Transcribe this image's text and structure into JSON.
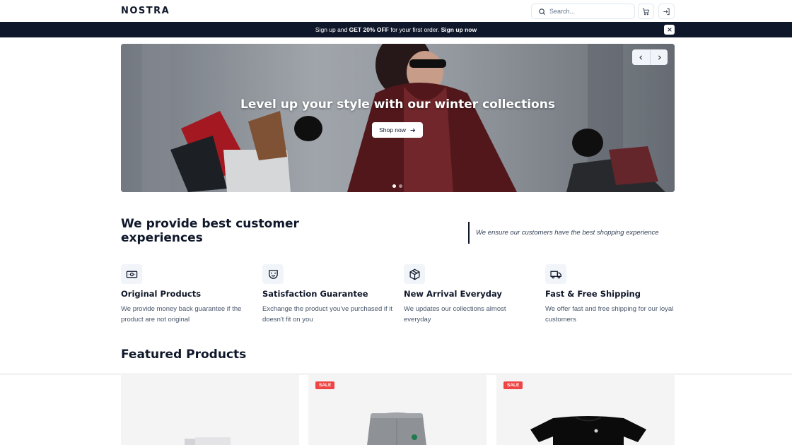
{
  "brand": {
    "logo": "NOSTRA"
  },
  "header": {
    "search": {
      "placeholder": "Search..."
    },
    "cart_icon": "cart-icon",
    "login_icon": "login-icon"
  },
  "announcement": {
    "text_1": "Sign up and ",
    "highlight": "GET 20% OFF",
    "text_2": " for your first order. ",
    "cta": "Sign up now",
    "close_icon": "close-icon"
  },
  "hero": {
    "title": "Level up your style with our winter collections",
    "button_label": "Shop now",
    "slide_count": 2,
    "active_slide": 1
  },
  "experience": {
    "title": "We provide best customer experiences",
    "subtitle": "We ensure our customers have the best shopping experience",
    "features": [
      {
        "icon": "money-icon",
        "title": "Original Products",
        "desc": "We provide money back guarantee if the product are not original"
      },
      {
        "icon": "smile-mask-icon",
        "title": "Satisfaction Guarantee",
        "desc": "Exchange the product you've purchased if it doesn't fit on you"
      },
      {
        "icon": "package-icon",
        "title": "New Arrival Everyday",
        "desc": "We updates our collections almost everyday"
      },
      {
        "icon": "truck-icon",
        "title": "Fast & Free Shipping",
        "desc": "We offer fast and free shipping for our loyal customers"
      }
    ]
  },
  "featured": {
    "title": "Featured Products",
    "products": [
      {
        "badge": ""
      },
      {
        "badge": "SALE"
      },
      {
        "badge": "SALE"
      }
    ]
  },
  "colors": {
    "dark": "#0f172a",
    "sale": "#ef4444",
    "muted": "#475569"
  }
}
